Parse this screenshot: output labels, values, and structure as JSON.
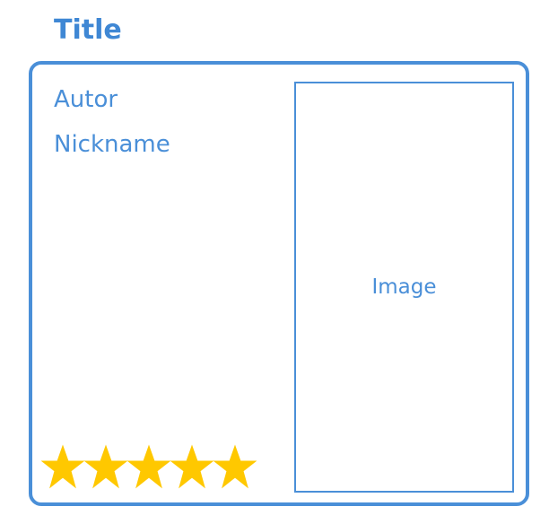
{
  "title": "Title",
  "card": {
    "author": "Autor",
    "nickname": "Nickname",
    "image_label": "Image",
    "rating": {
      "value": 5,
      "max": 5,
      "star_color": "#ffc800"
    }
  },
  "colors": {
    "accent": "#4a8fd8"
  }
}
